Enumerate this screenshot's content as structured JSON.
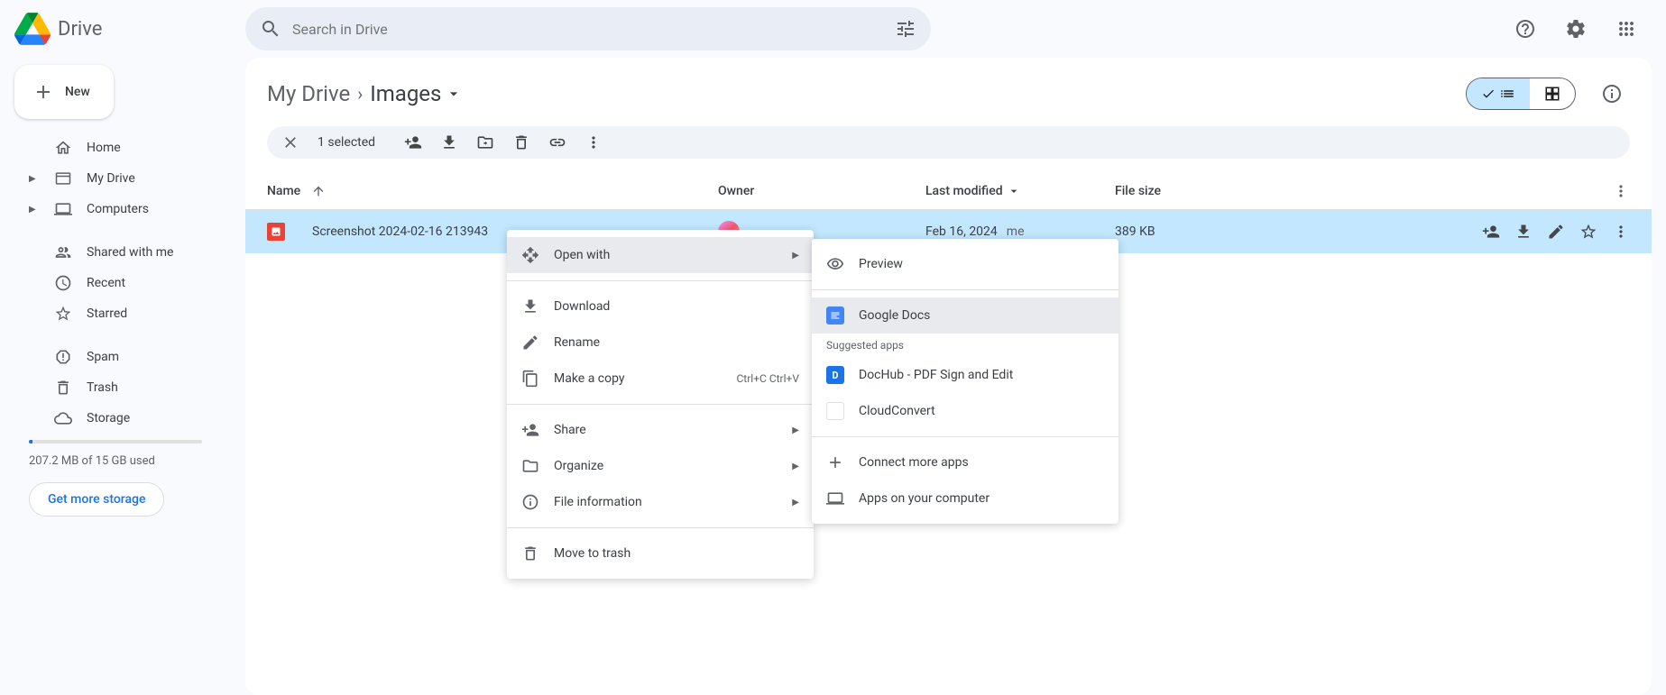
{
  "app": {
    "title": "Drive"
  },
  "search": {
    "placeholder": "Search in Drive"
  },
  "sidebar": {
    "new_label": "New",
    "items": [
      {
        "label": "Home"
      },
      {
        "label": "My Drive"
      },
      {
        "label": "Computers"
      },
      {
        "label": "Shared with me"
      },
      {
        "label": "Recent"
      },
      {
        "label": "Starred"
      },
      {
        "label": "Spam"
      },
      {
        "label": "Trash"
      },
      {
        "label": "Storage"
      }
    ],
    "storage_text": "207.2 MB of 15 GB used",
    "storage_btn": "Get more storage"
  },
  "breadcrumb": {
    "root": "My Drive",
    "current": "Images"
  },
  "selection": {
    "count_text": "1 selected"
  },
  "table": {
    "headers": {
      "name": "Name",
      "owner": "Owner",
      "modified": "Last modified",
      "size": "File size"
    },
    "rows": [
      {
        "name": "Screenshot 2024-02-16 213943",
        "modified": "Feb 16, 2024",
        "modified_by": "me",
        "size": "389 KB"
      }
    ]
  },
  "context_menu": {
    "items": [
      {
        "label": "Open with",
        "submenu": true
      },
      {
        "label": "Download"
      },
      {
        "label": "Rename"
      },
      {
        "label": "Make a copy",
        "shortcut": "Ctrl+C Ctrl+V"
      },
      {
        "label": "Share",
        "submenu": true
      },
      {
        "label": "Organize",
        "submenu": true
      },
      {
        "label": "File information",
        "submenu": true
      },
      {
        "label": "Move to trash"
      }
    ]
  },
  "submenu": {
    "preview": "Preview",
    "google_docs": "Google Docs",
    "suggested_header": "Suggested apps",
    "dochub": "DocHub - PDF Sign and Edit",
    "cloudconvert": "CloudConvert",
    "connect": "Connect more apps",
    "computer": "Apps on your computer"
  }
}
